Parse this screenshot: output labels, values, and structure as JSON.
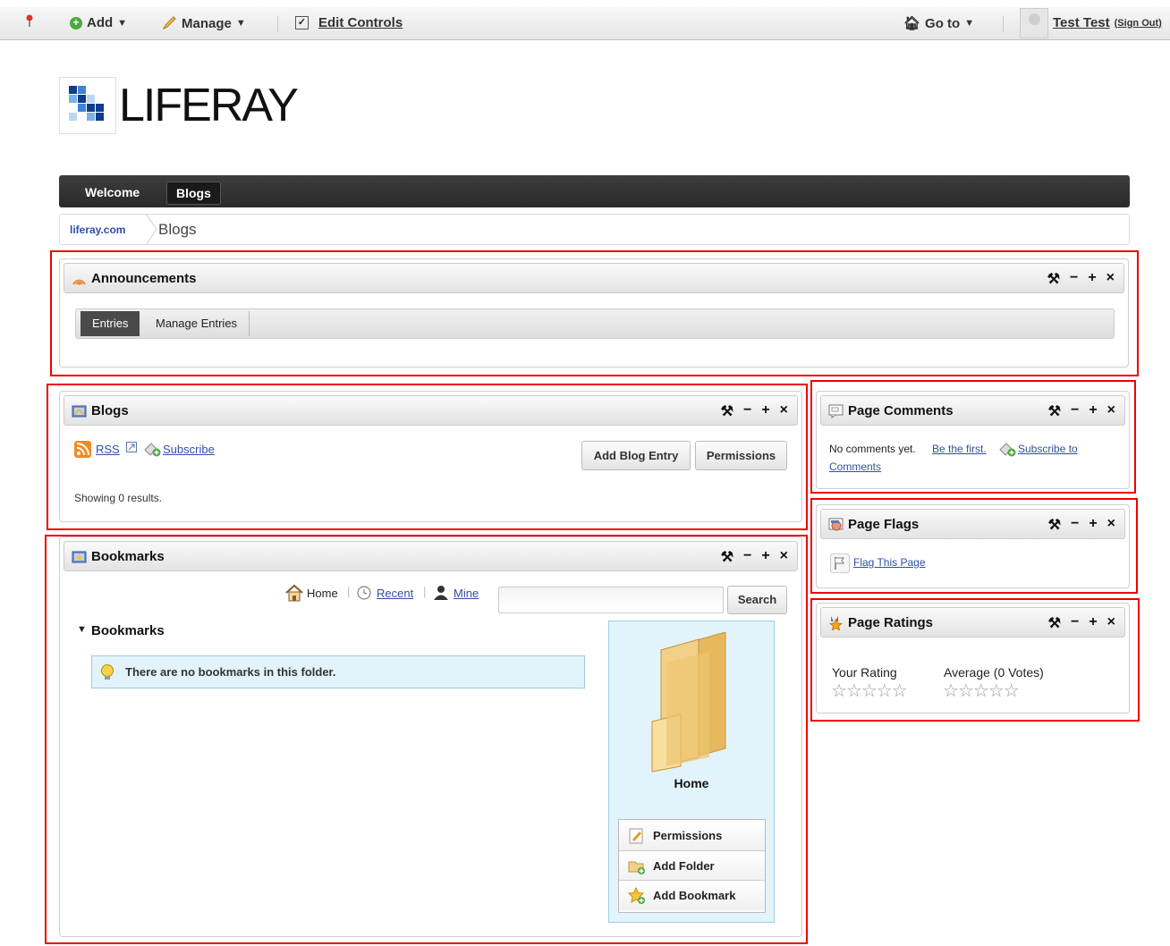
{
  "dockbar": {
    "add_label": "Add",
    "manage_label": "Manage",
    "edit_controls_label": "Edit Controls",
    "goto_label": "Go to",
    "user_name": "Test Test",
    "sign_out_label": "(Sign Out)",
    "dropdown_glyph": "▼"
  },
  "logo": {
    "text": "LIFERAY"
  },
  "nav": {
    "items": [
      {
        "label": "Welcome"
      },
      {
        "label": "Blogs"
      }
    ]
  },
  "breadcrumb": {
    "site": "liferay.com",
    "current": "Blogs"
  },
  "portlet_tools": {
    "config": "⚒",
    "minimize": "−",
    "maximize": "+",
    "close": "×"
  },
  "announcements": {
    "title": "Announcements",
    "tabs": [
      {
        "label": "Entries"
      },
      {
        "label": "Manage Entries"
      }
    ]
  },
  "blogs": {
    "title": "Blogs",
    "rss_label": "RSS",
    "subscribe_label": "Subscribe",
    "add_entry_label": "Add Blog Entry",
    "permissions_label": "Permissions",
    "results_text": "Showing 0 results."
  },
  "bookmarks": {
    "title": "Bookmarks",
    "home_label": "Home",
    "recent_label": "Recent",
    "mine_label": "Mine",
    "search_placeholder": "",
    "search_button": "Search",
    "section_title": "Bookmarks",
    "empty_message": "There are no bookmarks in this folder.",
    "folder_name": "Home",
    "actions": [
      {
        "label": "Permissions"
      },
      {
        "label": "Add Folder"
      },
      {
        "label": "Add Bookmark"
      }
    ]
  },
  "page_comments": {
    "title": "Page Comments",
    "no_comments": "No comments yet.",
    "be_first": "Be the first.",
    "subscribe_line1": "Subscribe to",
    "subscribe_line2": "Comments"
  },
  "page_flags": {
    "title": "Page Flags",
    "flag_label": "Flag This Page"
  },
  "page_ratings": {
    "title": "Page Ratings",
    "your_rating_label": "Your Rating",
    "average_label": "Average (0 Votes)",
    "your_rating_value": 0,
    "average_value": 0,
    "max_stars": 5
  },
  "colors": {
    "highlight": "#e00000",
    "link": "#2f4fa6",
    "nav_bg": "#333333",
    "info_bg": "#e3f3fb"
  }
}
